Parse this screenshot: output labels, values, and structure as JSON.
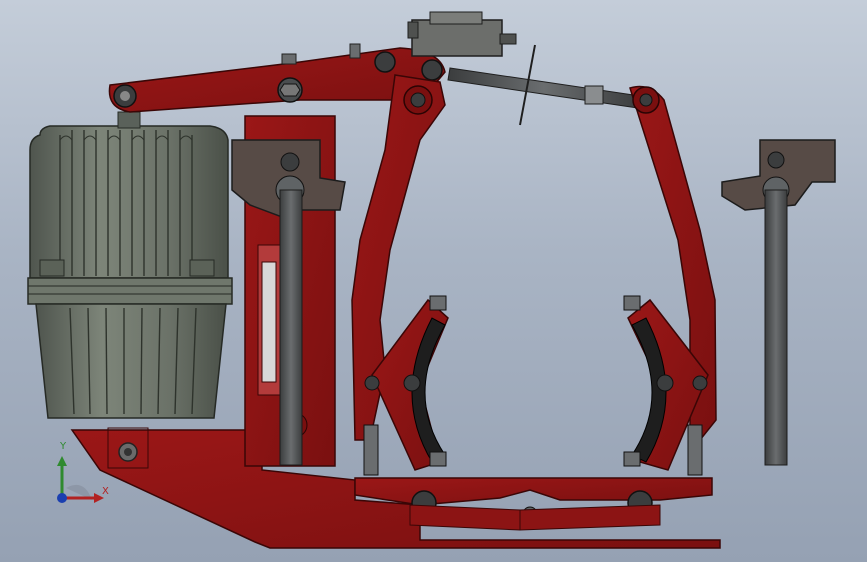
{
  "viewport": {
    "description_name": "cad-3d-viewport",
    "colors": {
      "brake_red": "#8c1414",
      "brake_red_dark": "#5c0a0a",
      "motor_gray": "#6d746b",
      "steel_gray": "#55585a",
      "background_top": "#c4cdd9",
      "background_bottom": "#95a1b3"
    }
  },
  "triad": {
    "x_label": "X",
    "y_label": "Y",
    "x_color": "#b22222",
    "y_color": "#2f8a2f",
    "z_color": "#1a3fb0"
  }
}
